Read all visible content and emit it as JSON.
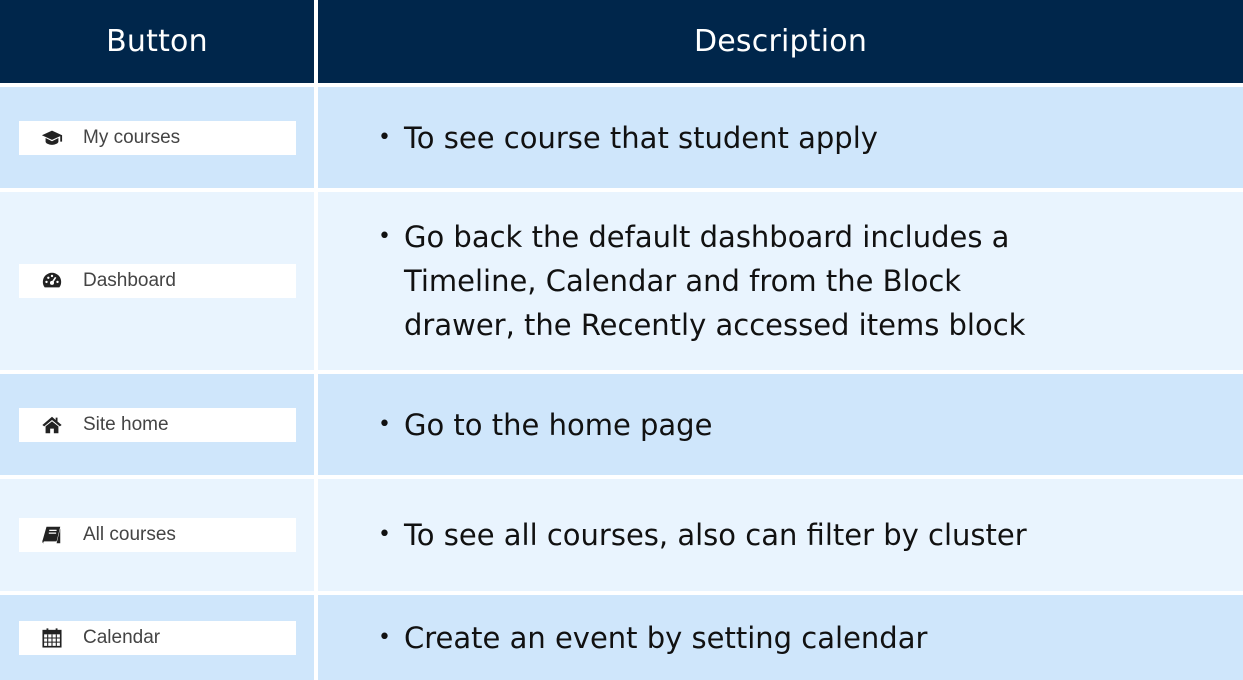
{
  "header": {
    "button_col": "Button",
    "description_col": "Description"
  },
  "rows": [
    {
      "button": {
        "label": "My courses",
        "icon": "graduation-cap-icon"
      },
      "description": "To see course that student apply"
    },
    {
      "button": {
        "label": "Dashboard",
        "icon": "dashboard-gauge-icon"
      },
      "description_lines": [
        "Go back the default dashboard includes a",
        "Timeline, Calendar and from the Block",
        "drawer, the Recently accessed items block"
      ]
    },
    {
      "button": {
        "label": "Site home",
        "icon": "home-icon"
      },
      "description": "Go to the home page"
    },
    {
      "button": {
        "label": "All courses",
        "icon": "book-icon"
      },
      "description": "To see all courses, also can filter by cluster"
    },
    {
      "button": {
        "label": "Calendar",
        "icon": "calendar-icon"
      },
      "description": "Create an event by setting calendar"
    }
  ],
  "colors": {
    "header_bg": "#00264b",
    "row_dark": "#cfe6fb",
    "row_light": "#e9f4fe"
  }
}
